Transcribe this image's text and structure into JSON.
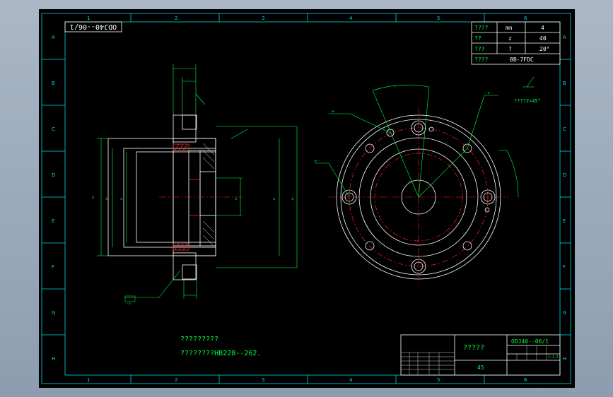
{
  "title_block": {
    "drawing_no": "ODJ40--06/1",
    "drawing_no_mirrored": "ODJ40--06/1",
    "name": "?????",
    "material": "45",
    "scale": "1:1.5"
  },
  "gear_params": [
    {
      "label": "????",
      "symbol": "mn",
      "value": "4"
    },
    {
      "label": "??",
      "symbol": "z",
      "value": "40"
    },
    {
      "label": "???",
      "symbol": "?",
      "value": "20°"
    },
    {
      "label": "????",
      "symbol": "",
      "value": "8B-7FDC"
    }
  ],
  "notes": {
    "line1": "?????????",
    "line2": "????????HB228--262."
  },
  "annotations": {
    "chamfer": "????2×45°"
  },
  "zones": {
    "columns": [
      "1",
      "2",
      "3",
      "4",
      "5",
      "6"
    ],
    "rows": [
      "A",
      "B",
      "C",
      "D",
      "E",
      "F",
      "G",
      "H"
    ]
  },
  "colors": {
    "background": "#000000",
    "border": "#00d7e6",
    "outline": "#ffffff",
    "dimension": "#00ff44",
    "centerline": "#ff2020",
    "hatch": "#ff3030"
  }
}
